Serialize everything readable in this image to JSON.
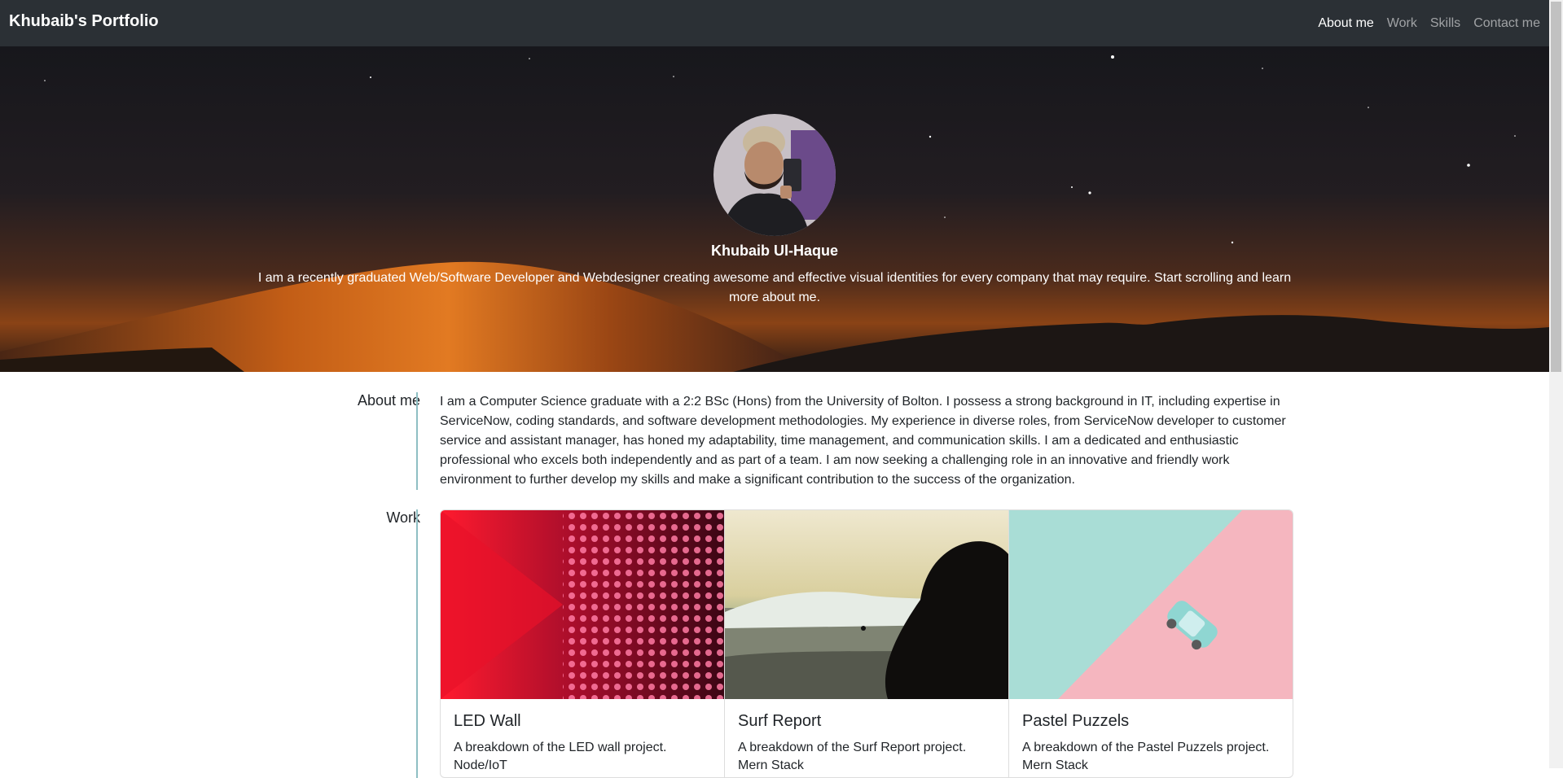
{
  "navbar": {
    "brand": "Khubaib's Portfolio",
    "links": [
      {
        "label": "About me",
        "active": true
      },
      {
        "label": "Work",
        "active": false
      },
      {
        "label": "Skills",
        "active": false
      },
      {
        "label": "Contact me",
        "active": false
      }
    ]
  },
  "hero": {
    "name": "Khubaib Ul-Haque",
    "description": "I am a recently graduated Web/Software Developer and Webdesigner creating awesome and effective visual identities for every company that may require. Start scrolling and learn more about me."
  },
  "about": {
    "heading": "About me",
    "text": "I am a Computer Science graduate with a 2:2 BSc (Hons) from the University of Bolton. I possess a strong background in IT, including expertise in ServiceNow, coding standards, and software development methodologies. My experience in diverse roles, from ServiceNow developer to customer service and assistant manager, has honed my adaptability, time management, and communication skills. I am a dedicated and enthusiastic professional who excels both independently and as part of a team. I am now seeking a challenging role in an innovative and friendly work environment to further develop my skills and make a significant contribution to the success of the organization."
  },
  "work": {
    "heading": "Work",
    "cards": [
      {
        "title": "LED Wall",
        "text": "A breakdown of the LED wall project.",
        "stack": "Node/IoT"
      },
      {
        "title": "Surf Report",
        "text": "A breakdown of the Surf Report project.",
        "stack": "Mern Stack"
      },
      {
        "title": "Pastel Puzzels",
        "text": "A breakdown of the Pastel Puzzels project.",
        "stack": "Mern Stack"
      }
    ]
  },
  "colors": {
    "navbar_bg": "#2b3035",
    "section_line": "#8fbfc3",
    "desert_orange": "#d9701e"
  }
}
